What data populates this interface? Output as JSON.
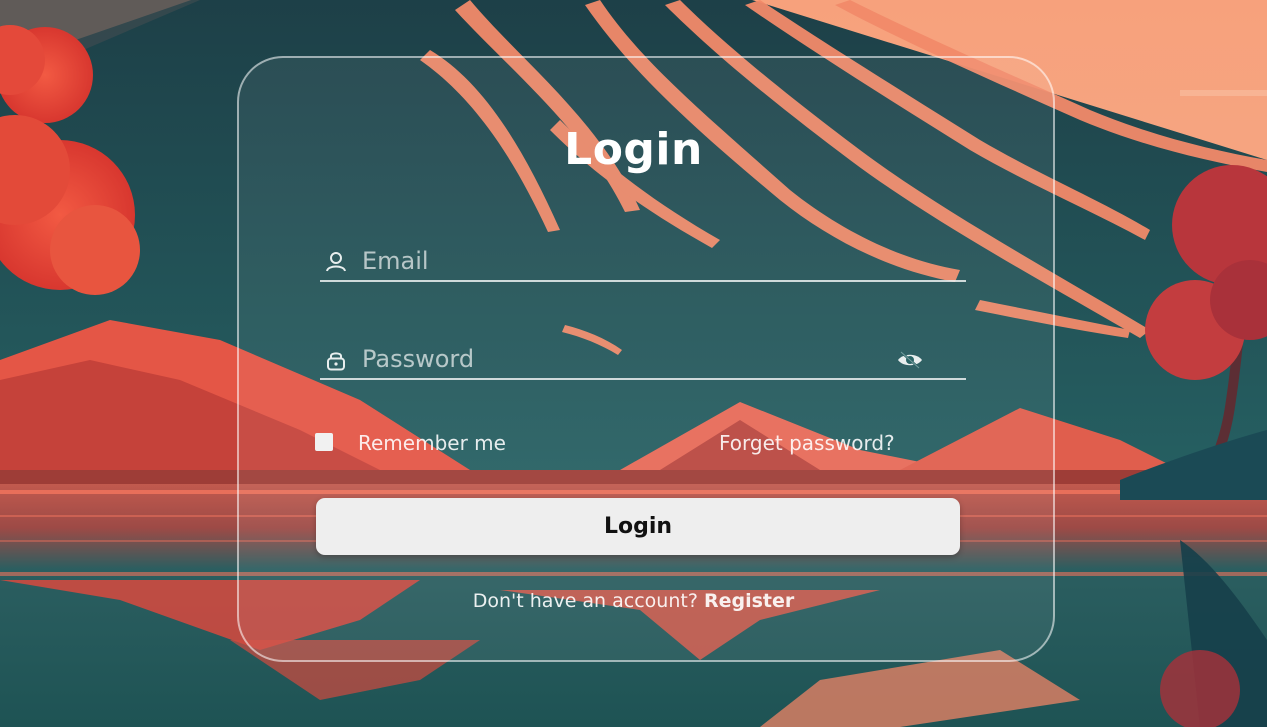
{
  "page": {
    "title": "Login"
  },
  "form": {
    "email": {
      "placeholder": "Email",
      "icon": "user-icon"
    },
    "password": {
      "placeholder": "Password",
      "icon": "lock-icon",
      "toggle_icon": "eye-slash-icon"
    },
    "remember_label": "Remember me",
    "remember_checked": false,
    "forgot_label": "Forget password?",
    "submit_label": "Login",
    "register_prefix": "Don't have an account?",
    "register_link": "Register"
  },
  "colors": {
    "accent": "#ff6f5b",
    "sky": "#f2a37c",
    "water": "#1f5b5c",
    "card_border": "#ffffff",
    "button_bg": "#eeeeee",
    "button_text": "#111111"
  }
}
